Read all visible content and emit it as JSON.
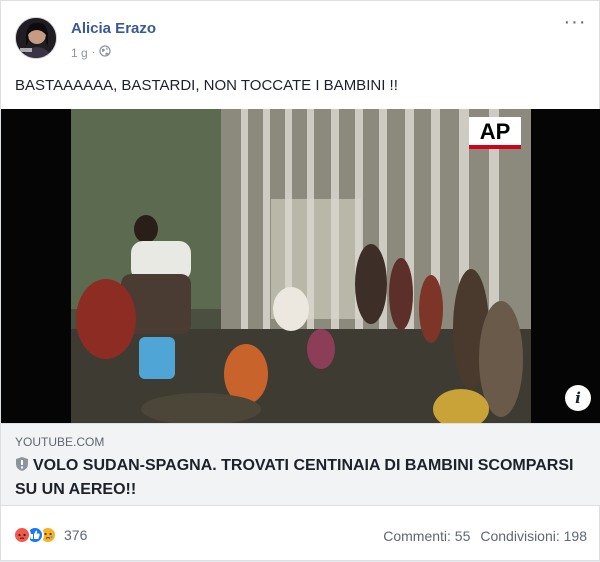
{
  "post": {
    "author": "Alicia Erazo",
    "time": "1 g",
    "time_separator": "·",
    "privacy_icon": "globe-icon",
    "more_label": "···",
    "text": "BASTAAAAAA, BASTARDI, NON TOCCATE I BAMBINI !!"
  },
  "video": {
    "watermark": "AP",
    "info_label": "i"
  },
  "link": {
    "domain": "YOUTUBE.COM",
    "title": "VOLO SUDAN-SPAGNA. TROVATI CENTINAIA DI BAMBINI SCOMPARSI SU UN AEREO!!"
  },
  "footer": {
    "reaction_icons": [
      "angry-reaction-icon",
      "like-reaction-icon",
      "sad-reaction-icon"
    ],
    "reaction_count": "376",
    "comments": "Commenti: 55",
    "shares": "Condivisioni: 198"
  },
  "colors": {
    "author": "#385898",
    "text": "#1d2129",
    "muted": "#606770",
    "link_bg": "#f2f3f5",
    "ap_red": "#d0021b"
  }
}
